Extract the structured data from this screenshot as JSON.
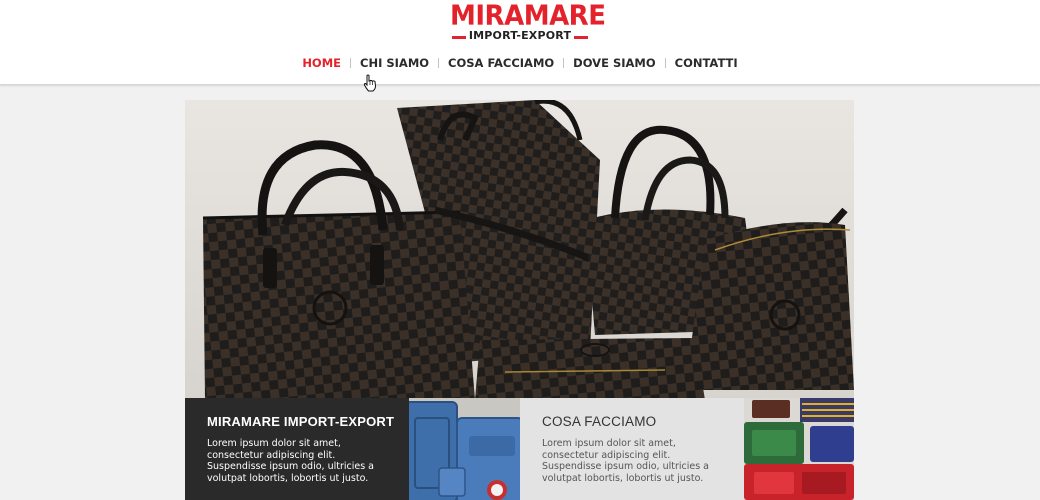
{
  "brand": {
    "name": "MIRAMARE",
    "tagline": "IMPORT-EXPORT",
    "color": "#e3222b"
  },
  "nav": {
    "items": [
      {
        "label": "HOME",
        "active": true
      },
      {
        "label": "CHI SIAMO",
        "active": false
      },
      {
        "label": "COSA FACCIAMO",
        "active": false
      },
      {
        "label": "DOVE SIAMO",
        "active": false
      },
      {
        "label": "CONTATTI",
        "active": false
      }
    ],
    "active_color": "#e3222b"
  },
  "hero": {
    "image": "checkered-leather-handbags-photo"
  },
  "panels": [
    {
      "title": "MIRAMARE IMPORT-EXPORT",
      "text": "Lorem ipsum dolor sit amet, consectetur adipiscing elit. Suspendisse ipsum odio, ultricies a volutpat lobortis, lobortis ut justo.",
      "theme": "dark"
    },
    {
      "title": "COSA FACCIAMO",
      "text": "Lorem ipsum dolor sit amet, consectetur adipiscing elit. Suspendisse ipsum odio, ultricies a volutpat lobortis, lobortis ut justo.",
      "theme": "light"
    }
  ],
  "thumbnails": [
    {
      "image": "blue-suitcases-photo"
    },
    {
      "image": "colorful-wallets-photo"
    }
  ]
}
